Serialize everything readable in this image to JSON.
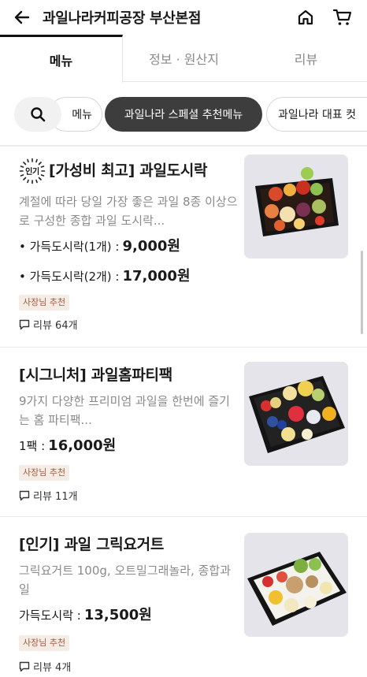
{
  "header": {
    "title": "과일나라커피공장 부산본점"
  },
  "tabs": [
    {
      "label": "메뉴",
      "active": true
    },
    {
      "label": "정보 · 원산지",
      "active": false
    },
    {
      "label": "리뷰",
      "active": false
    }
  ],
  "categories": {
    "prev_partial": "메뉴",
    "active": "과일나라 스페셜 추천메뉴",
    "next_partial": "과일나라 대표 컷"
  },
  "items": [
    {
      "popular_badge": "인기",
      "title": "[가성비 최고] 과일도시락",
      "description": "계절에 따라 당일 가장 좋은 과일 8종 이상으로 구성한 종합 과일 도시락...",
      "options": [
        {
          "label": "• 가득도시락(1개) :",
          "price": "9,000원"
        },
        {
          "label": "• 가득도시락(2개) :",
          "price": "17,000원"
        }
      ],
      "badge": "사장님 추천",
      "reviews": "리뷰 64개"
    },
    {
      "title": "[시그니처] 과일홈파티팩",
      "description": "9가지 다양한 프리미엄 과일을 한번에 즐기는 홈 파티팩...",
      "options": [
        {
          "label": "1팩 :",
          "price": "16,000원"
        }
      ],
      "badge": "사장님 추천",
      "reviews": "리뷰 11개"
    },
    {
      "title": "[인기] 과일 그릭요거트",
      "description": "그릭요거트 100g, 오트밀그래놀라, 종합과일",
      "options": [
        {
          "label": "가득도시락 :",
          "price": "13,500원"
        }
      ],
      "badge": "사장님 추천",
      "reviews": "리뷰 4개"
    }
  ],
  "colors": {
    "active_chip": "#3d3d3d",
    "badge_bg": "#f6ece6",
    "badge_text": "#9e5b3f",
    "muted_text": "#8a8a8a"
  },
  "icons": [
    "back-arrow-icon",
    "home-icon",
    "cart-icon",
    "search-icon",
    "speech-bubble-icon",
    "popular-sun-icon"
  ]
}
